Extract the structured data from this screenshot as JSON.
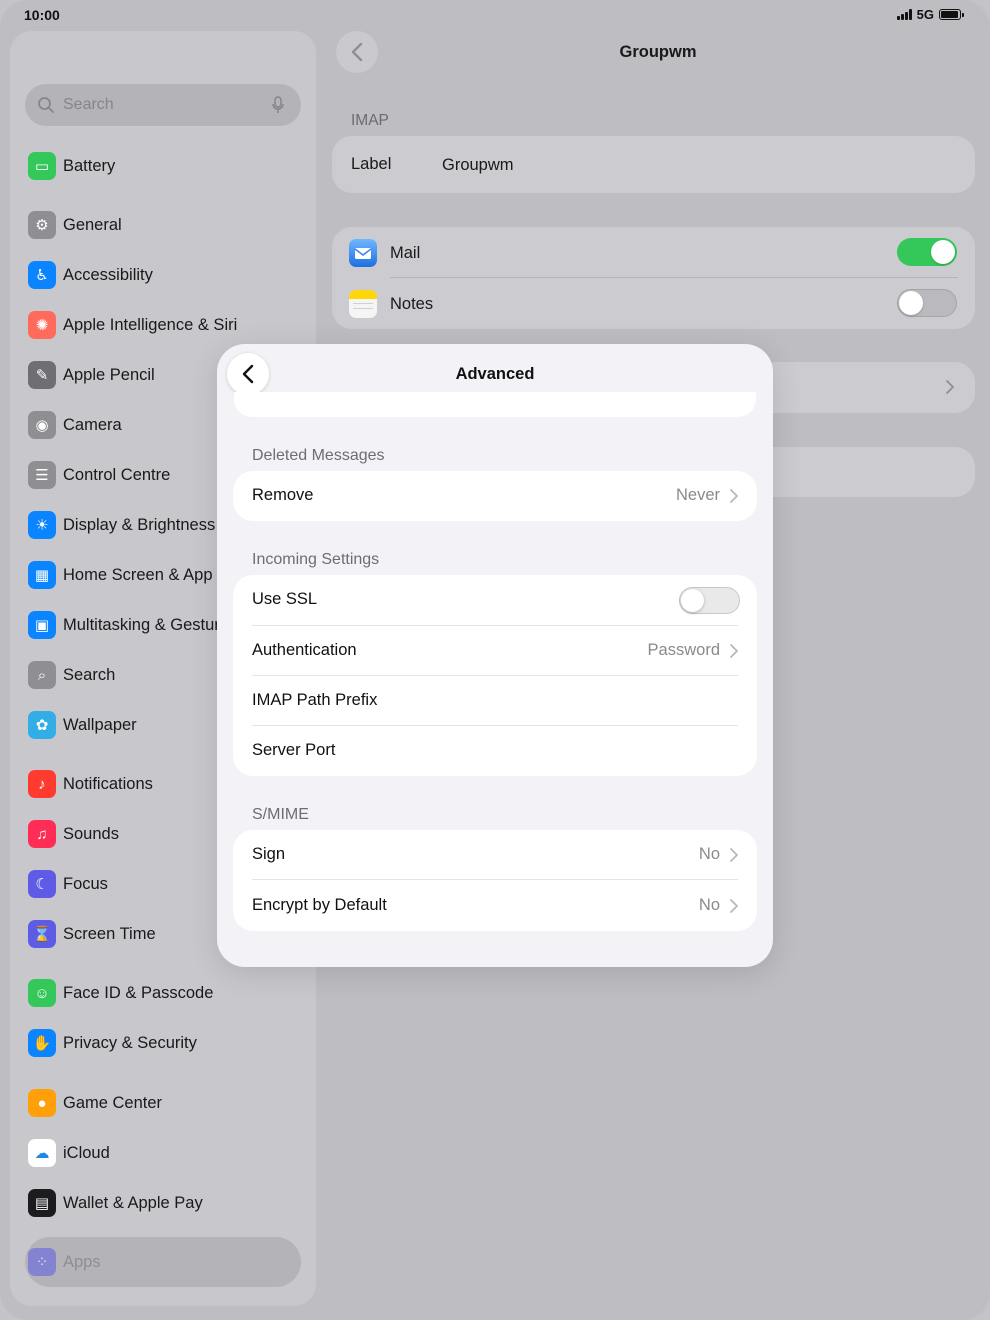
{
  "status": {
    "time": "10:00",
    "network": "5G"
  },
  "sidebar": {
    "search_placeholder": "Search",
    "items": [
      {
        "label": "Battery",
        "icon": "battery-icon",
        "color": "#34c759"
      },
      {
        "label": "General",
        "icon": "gear-icon",
        "color": "#8e8e93"
      },
      {
        "label": "Accessibility",
        "icon": "accessibility-icon",
        "color": "#0a84ff"
      },
      {
        "label": "Apple Intelligence & Siri",
        "icon": "siri-icon",
        "color": "#ff6a5c"
      },
      {
        "label": "Apple Pencil",
        "icon": "pencil-icon",
        "color": "#6e6e73"
      },
      {
        "label": "Camera",
        "icon": "camera-icon",
        "color": "#8e8e93"
      },
      {
        "label": "Control Centre",
        "icon": "toggles-icon",
        "color": "#8e8e93"
      },
      {
        "label": "Display & Brightness",
        "icon": "sun-icon",
        "color": "#0a84ff"
      },
      {
        "label": "Home Screen & App Library",
        "icon": "home-screen-icon",
        "color": "#0a84ff"
      },
      {
        "label": "Multitasking & Gestures",
        "icon": "multitasking-icon",
        "color": "#0a84ff"
      },
      {
        "label": "Search",
        "icon": "search-icon",
        "color": "#8e8e93"
      },
      {
        "label": "Wallpaper",
        "icon": "flower-icon",
        "color": "#32ade6"
      },
      {
        "label": "Notifications",
        "icon": "bell-icon",
        "color": "#ff3b30"
      },
      {
        "label": "Sounds",
        "icon": "speaker-icon",
        "color": "#ff2d55"
      },
      {
        "label": "Focus",
        "icon": "moon-icon",
        "color": "#5e5ce6"
      },
      {
        "label": "Screen Time",
        "icon": "hourglass-icon",
        "color": "#5e5ce6"
      },
      {
        "label": "Face ID & Passcode",
        "icon": "face-id-icon",
        "color": "#34c759"
      },
      {
        "label": "Privacy & Security",
        "icon": "hand-icon",
        "color": "#0a84ff"
      },
      {
        "label": "Game Center",
        "icon": "game-center-icon",
        "color": "#ff9f0a"
      },
      {
        "label": "iCloud",
        "icon": "cloud-icon",
        "color": "#ffffff"
      },
      {
        "label": "Wallet & Apple Pay",
        "icon": "wallet-icon",
        "color": "#1c1c1e"
      },
      {
        "label": "Apps",
        "icon": "apps-grid-icon",
        "color": "#5e5ce6"
      }
    ]
  },
  "detail": {
    "title": "Groupwm",
    "imap_header": "IMAP",
    "label_key": "Label",
    "label_value": "Groupwm",
    "mail_label": "Mail",
    "mail_on": true,
    "notes_label": "Notes",
    "notes_on": false
  },
  "modal": {
    "title": "Advanced",
    "deleted_header": "Deleted Messages",
    "remove_label": "Remove",
    "remove_value": "Never",
    "incoming_header": "Incoming Settings",
    "use_ssl_label": "Use SSL",
    "use_ssl_on": false,
    "auth_label": "Authentication",
    "auth_value": "Password",
    "imap_prefix_label": "IMAP Path Prefix",
    "server_port_label": "Server Port",
    "smime_header": "S/MIME",
    "sign_label": "Sign",
    "sign_value": "No",
    "encrypt_label": "Encrypt by Default",
    "encrypt_value": "No"
  },
  "colors": {
    "toggle_on": "#34c759",
    "accent": "#0a84ff"
  }
}
